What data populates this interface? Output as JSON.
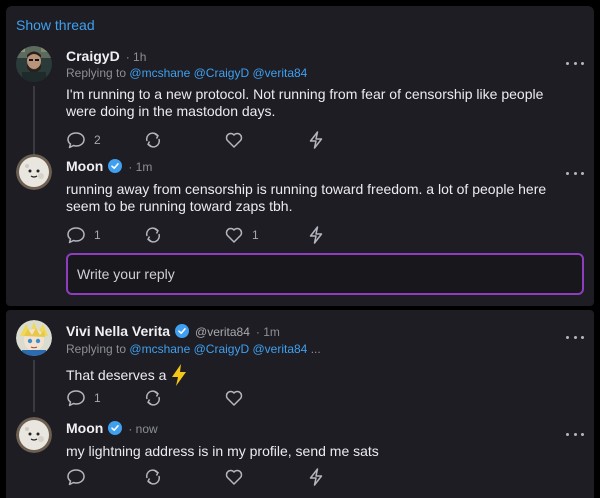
{
  "thread": {
    "show_thread_label": "Show thread"
  },
  "posts": [
    {
      "author": "CraigyD",
      "timestamp": "1h",
      "replying_label": "Replying to",
      "mentions": [
        "@mcshane",
        "@CraigyD",
        "@verita84"
      ],
      "content": "I'm running to a new protocol. Not running from fear of censorship like people were doing in the mastodon days.",
      "reply_count": "2",
      "repost_count": "",
      "like_count": ""
    },
    {
      "author": "Moon",
      "verified": true,
      "timestamp": "1m",
      "content": "running away from censorship is running toward freedom. a lot of people here seem to be running toward zaps tbh.",
      "reply_count": "1",
      "repost_count": "",
      "like_count": "1"
    },
    {
      "author": "Vivi Nella Verita",
      "verified": true,
      "handle": "@verita84",
      "timestamp": "1m",
      "replying_label": "Replying to",
      "mentions": [
        "@mcshane",
        "@CraigyD",
        "@verita84"
      ],
      "mentions_more": "...",
      "content": "That deserves a",
      "content_emoji": "⚡",
      "reply_count": "1",
      "repost_count": "",
      "like_count": ""
    },
    {
      "author": "Moon",
      "verified": true,
      "timestamp": "now",
      "content": "my lightning address is in my profile, send me sats",
      "reply_count": "",
      "repost_count": "",
      "like_count": ""
    }
  ],
  "reply_box": {
    "placeholder": "Write your reply"
  },
  "colors": {
    "background": "#1d1d23",
    "accent_blue": "#3fa0f0",
    "reply_border": "#8e3cc0",
    "bolt": "#f5c518"
  },
  "icons": [
    "avatar",
    "verified-badge-icon",
    "more-icon",
    "reply-icon",
    "repost-icon",
    "like-icon",
    "zap-icon",
    "lightning-emoji"
  ]
}
